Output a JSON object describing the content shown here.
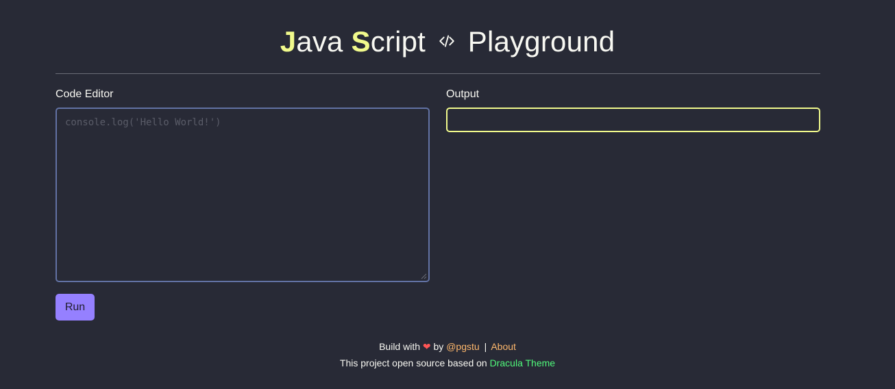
{
  "header": {
    "title_j": "J",
    "title_ava": "ava ",
    "title_s": "S",
    "title_cript": "cript",
    "title_rest": "Playground",
    "code_icon": "code-icon"
  },
  "editor": {
    "label": "Code Editor",
    "placeholder": "console.log('Hello World!')",
    "value": ""
  },
  "output": {
    "label": "Output",
    "value": ""
  },
  "actions": {
    "run_label": "Run"
  },
  "footer": {
    "build_with": "Build with",
    "heart_icon": "heart-icon",
    "heart_glyph": "❤",
    "by": "by",
    "author_link": "@pgstu",
    "separator": "|",
    "about_link": "About",
    "open_source_text": "This project open source based on",
    "theme_link": "Dracula Theme"
  },
  "colors": {
    "background": "#282a36",
    "accent_yellow": "#f1fa8c",
    "editor_border": "#6272a4",
    "button_purple": "#9580ff",
    "link_orange": "#ffb86c",
    "link_green": "#50fa7b",
    "heart_red": "#ff5555"
  }
}
